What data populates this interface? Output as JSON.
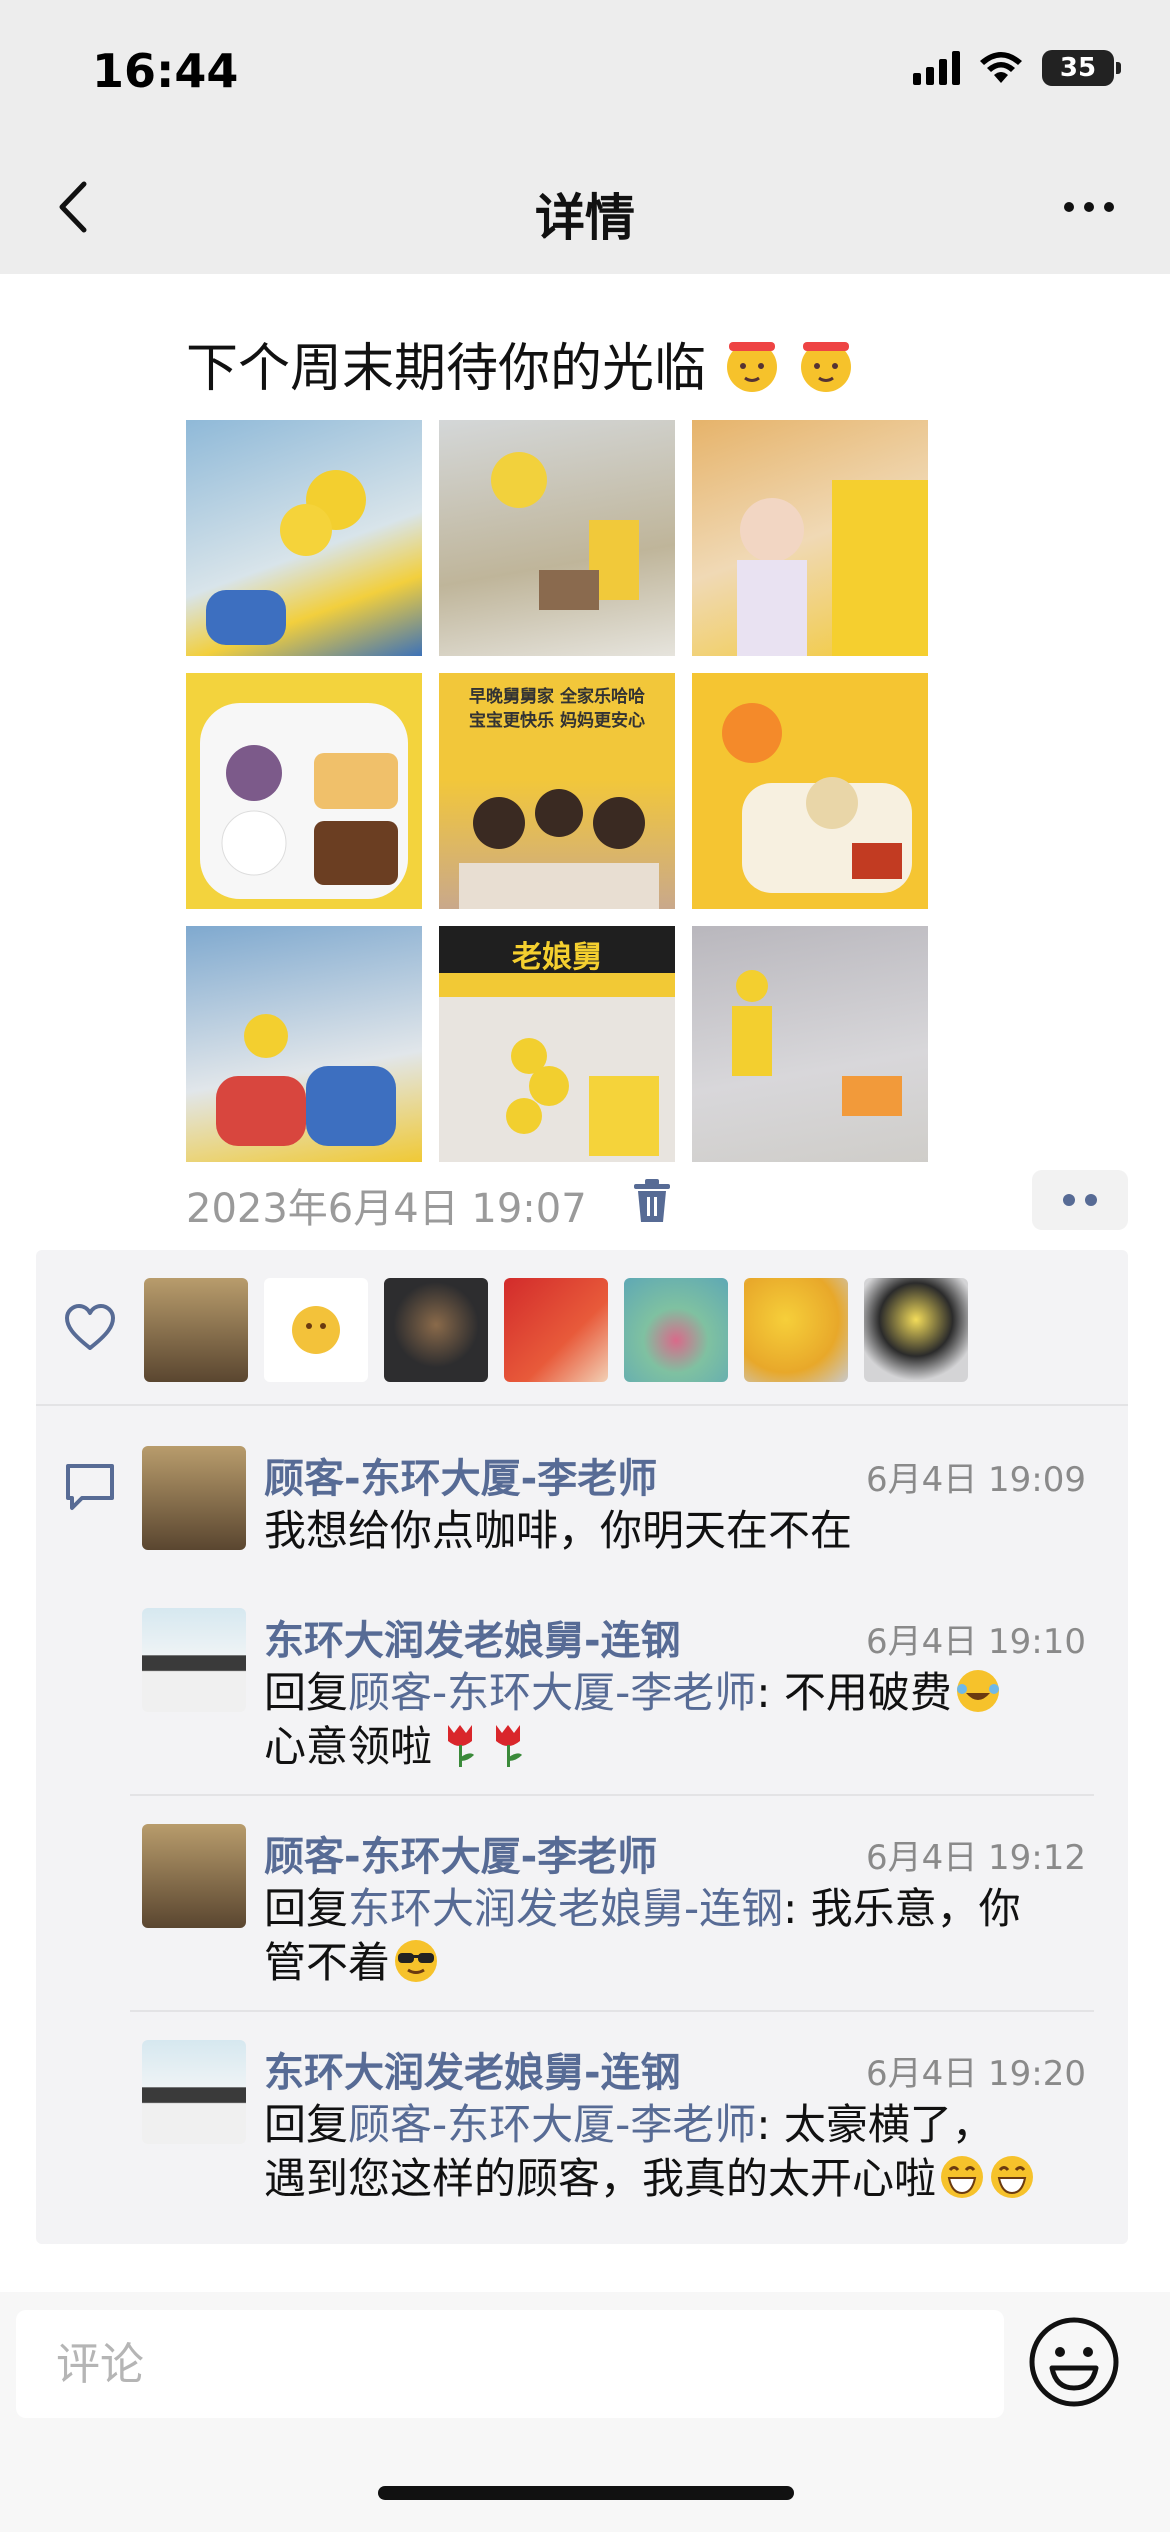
{
  "status_bar": {
    "time": "16:44",
    "battery": "35"
  },
  "nav": {
    "title": "详情",
    "back_icon": "chevron-left-icon",
    "more_icon": "ellipsis-icon"
  },
  "post": {
    "text": "下个周末期待你的光临",
    "photos": [
      {
        "bg": "#8fb9d8",
        "label": ""
      },
      {
        "bg": "#c9c2ae",
        "label": ""
      },
      {
        "bg": "#e2b36c",
        "label": ""
      },
      {
        "bg": "#f3d33d",
        "label": ""
      },
      {
        "bg": "#f2c73a",
        "label": "早晚舅舅家 全家乐哈哈\n宝宝更快乐 妈妈更安心"
      },
      {
        "bg": "#f5c532",
        "label": ""
      },
      {
        "bg": "#7fa9cf",
        "label": ""
      },
      {
        "bg": "#2b2b2b",
        "label": "老娘舅"
      },
      {
        "bg": "#b9b7bd",
        "label": ""
      }
    ],
    "timestamp": "2023年6月4日 19:07"
  },
  "likes": [
    {
      "bg": "#8a7654"
    },
    {
      "bg": "#ffffff"
    },
    {
      "bg": "#2d2d2f"
    },
    {
      "bg": "#d22b2b"
    },
    {
      "bg": "#5ea8b5"
    },
    {
      "bg": "#f1bc2c"
    },
    {
      "bg": "#c9c9cb"
    }
  ],
  "comments": [
    {
      "name": "顾客-东环大厦-李老师",
      "time": "6月4日 19:09",
      "text": "我想给你点咖啡，你明天在不在",
      "avatar_bg": "#8a7654"
    },
    {
      "name": "东环大润发老娘舅-连钢",
      "time": "6月4日 19:10",
      "reply_prefix": "回复",
      "reply_to": "顾客-东环大厦-李老师",
      "text_line1": ": 不用破费",
      "text_line2": "心意领啦",
      "avatar_bg": "#cfe1ea"
    },
    {
      "name": "顾客-东环大厦-李老师",
      "time": "6月4日 19:12",
      "reply_prefix": "回复",
      "reply_to": "东环大润发老娘舅-连钢",
      "text_line1": ": 我乐意，你",
      "text_line2": "管不着",
      "avatar_bg": "#8a7654"
    },
    {
      "name": "东环大润发老娘舅-连钢",
      "time": "6月4日 19:20",
      "reply_prefix": "回复",
      "reply_to": "顾客-东环大厦-李老师",
      "text_line1": ": 太豪横了，",
      "text_line2": "遇到您这样的顾客，我真的太开心啦",
      "avatar_bg": "#cfe1ea"
    }
  ],
  "input": {
    "placeholder": "评论"
  },
  "colors": {
    "link": "#576b95",
    "panel": "#f3f3f5",
    "nav_bg": "#ededed"
  }
}
